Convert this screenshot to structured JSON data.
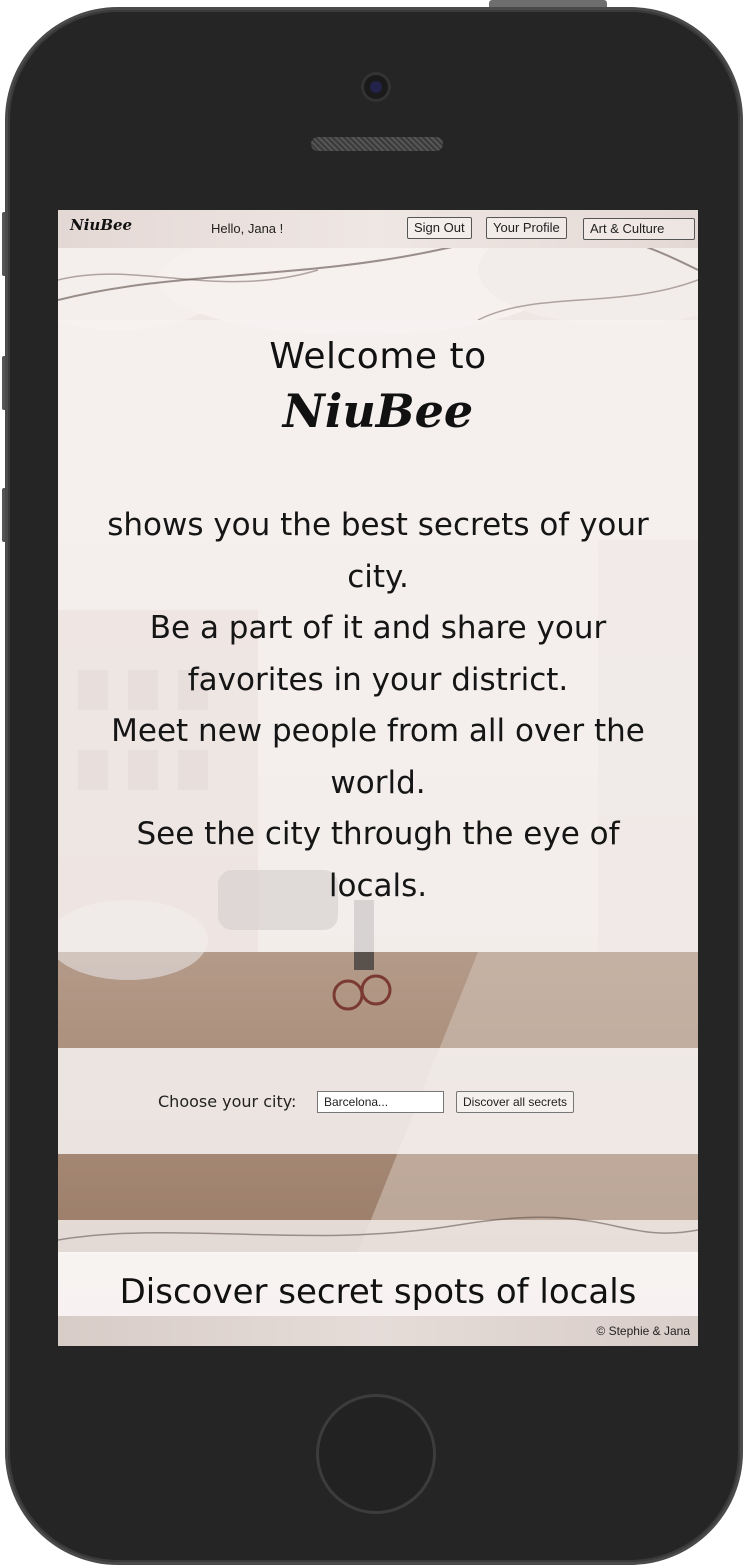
{
  "nav": {
    "brand": "NiuBee",
    "greeting": "Hello, Jana !",
    "sign_out": "Sign Out",
    "profile": "Your Profile",
    "category": "Art & Culture"
  },
  "hero": {
    "title": "Welcome to",
    "brand": "NiuBee",
    "lines": [
      "shows you the best secrets of your city.",
      "Be a part of it and share your favorites in your district.",
      "Meet new people from all over the world.",
      "See the city through the eye of locals."
    ]
  },
  "city_picker": {
    "label": "Choose your city:",
    "placeholder": "Barcelona...",
    "button": "Discover all secrets"
  },
  "discover": {
    "heading": "Discover secret spots of locals"
  },
  "footer": {
    "text": "© Stephie & Jana"
  }
}
